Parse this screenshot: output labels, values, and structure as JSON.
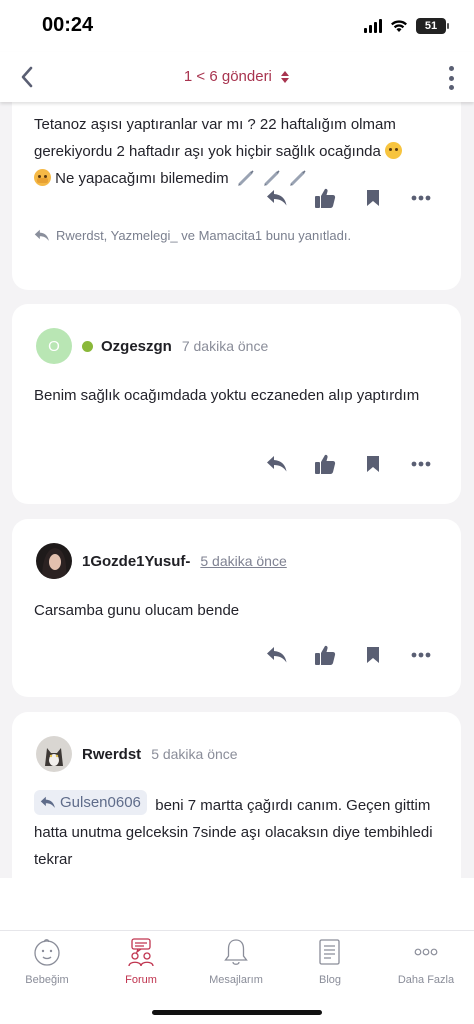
{
  "status": {
    "time": "00:24",
    "battery": "51"
  },
  "nav": {
    "title": "1 < 6 gönderi"
  },
  "posts": [
    {
      "text_before": "Tetanoz aşısı yaptıranlar var mı ? 22 haftalığım olmam gerekiyordu 2 haftadır aşı yok hiçbir sağlık ocağında",
      "text_after": "Ne yapacağımı bilemedim",
      "replied": "Rwerdst, Yazmelegi_ ve Mamacita1 bunu yanıtladı."
    },
    {
      "avatar_letter": "O",
      "username": "Ozgeszgn",
      "time": "7 dakika önce",
      "text": "Benim sağlık ocağımdada yoktu eczaneden alıp yaptırdım"
    },
    {
      "username": "1Gozde1Yusuf-",
      "time": "5 dakika önce",
      "text": "Carsamba gunu olucam bende"
    },
    {
      "username": "Rwerdst",
      "time": "5 dakika önce",
      "quote": "Gulsen0606",
      "text": "beni 7 martta çağırdı canım. Geçen gittim hatta unutma gelceksin 7sinde aşı olacaksın diye tembihledi tekrar"
    }
  ],
  "tabs": [
    {
      "label": "Bebeğim",
      "icon": "baby-face-icon"
    },
    {
      "label": "Forum",
      "icon": "forum-people-icon",
      "active": true
    },
    {
      "label": "Mesajlarım",
      "icon": "bell-icon"
    },
    {
      "label": "Blog",
      "icon": "document-icon"
    },
    {
      "label": "Daha Fazla",
      "icon": "more-dots-icon"
    }
  ],
  "colors": {
    "accent": "#c0344f",
    "icon_gray": "#5a5f73",
    "online": "#8ab83a"
  }
}
